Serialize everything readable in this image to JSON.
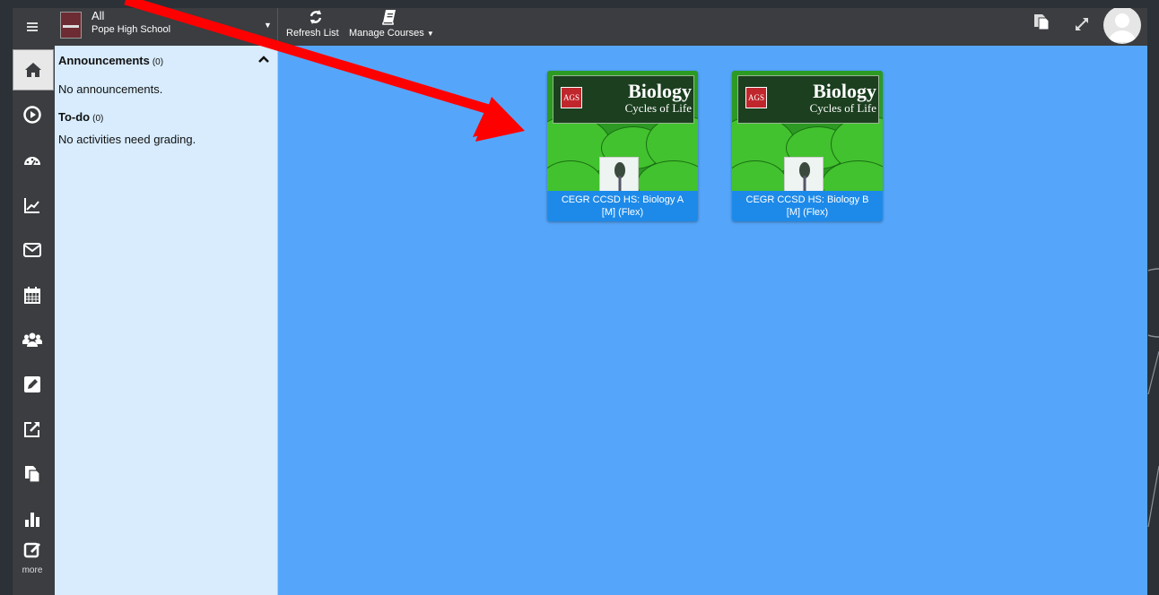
{
  "topbar": {
    "school_selector": {
      "filter": "All",
      "school": "Pope High School"
    },
    "tools": [
      {
        "label": "Refresh List",
        "icon": "refresh-icon"
      },
      {
        "label": "Manage Courses",
        "icon": "book-icon"
      }
    ],
    "right_icons": [
      "copy-icon",
      "expand-icon",
      "user-avatar"
    ]
  },
  "rail": {
    "items": [
      {
        "icon": "home-icon",
        "active": true
      },
      {
        "icon": "play-icon"
      },
      {
        "icon": "dashboard-icon"
      },
      {
        "icon": "analytics-icon"
      },
      {
        "icon": "mail-icon"
      },
      {
        "icon": "calendar-icon"
      },
      {
        "icon": "users-icon"
      },
      {
        "icon": "edit-icon"
      },
      {
        "icon": "external-link-icon"
      },
      {
        "icon": "copy-icon"
      },
      {
        "icon": "bar-chart-icon"
      },
      {
        "icon": "grade-icon"
      }
    ],
    "more_label": "more"
  },
  "panel": {
    "announcements": {
      "title": "Announcements",
      "count": "(0)",
      "message": "No announcements."
    },
    "todo": {
      "title": "To-do",
      "count": "(0)",
      "message": "No activities need grading."
    }
  },
  "courses": [
    {
      "cover_title": "Biology",
      "cover_subtitle": "Cycles of Life",
      "cover_logo": "AGS",
      "name_line1": "CEGR CCSD HS: Biology A",
      "name_line2": "[M] (Flex)"
    },
    {
      "cover_title": "Biology",
      "cover_subtitle": "Cycles of Life",
      "cover_logo": "AGS",
      "name_line1": "CEGR CCSD HS: Biology B",
      "name_line2": "[M] (Flex)"
    }
  ],
  "colors": {
    "content_bg": "#55a6fb",
    "panel_bg": "#d8ecfd",
    "bar_bg": "#3b3d40",
    "card_label_bg": "#1d8ae9",
    "annotation_arrow": "#ff0000"
  }
}
